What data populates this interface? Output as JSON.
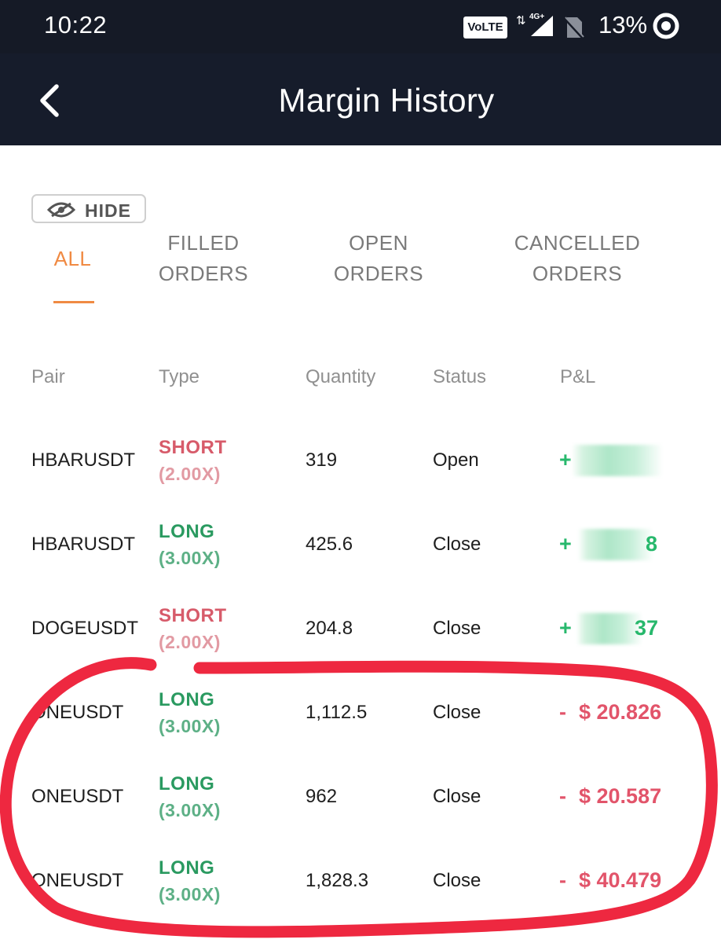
{
  "status_bar": {
    "time": "10:22",
    "volte": "VoLTE",
    "network": "4G+",
    "battery": "13%"
  },
  "header": {
    "title": "Margin History"
  },
  "filter": {
    "hide_label": "HIDE"
  },
  "tabs": [
    {
      "line1": "ALL",
      "line2": "",
      "active": true
    },
    {
      "line1": "FILLED",
      "line2": "ORDERS",
      "active": false
    },
    {
      "line1": "OPEN",
      "line2": "ORDERS",
      "active": false
    },
    {
      "line1": "CANCELLED",
      "line2": "ORDERS",
      "active": false
    }
  ],
  "table": {
    "columns": [
      "Pair",
      "Type",
      "Quantity",
      "Status",
      "P&L"
    ],
    "rows": [
      {
        "pair": "HBARUSDT",
        "side": "SHORT",
        "leverage": "(2.00X)",
        "quantity": "319",
        "status": "Open",
        "pnl_sign": "+",
        "pnl_value": "",
        "pnl_visible": "",
        "pnl_redacted": true
      },
      {
        "pair": "HBARUSDT",
        "side": "LONG",
        "leverage": "(3.00X)",
        "quantity": "425.6",
        "status": "Close",
        "pnl_sign": "+",
        "pnl_value": "",
        "pnl_visible": "8",
        "pnl_redacted": true
      },
      {
        "pair": "DOGEUSDT",
        "side": "SHORT",
        "leverage": "(2.00X)",
        "quantity": "204.8",
        "status": "Close",
        "pnl_sign": "+",
        "pnl_value": "",
        "pnl_visible": "37",
        "pnl_redacted": true
      },
      {
        "pair": "ONEUSDT",
        "side": "LONG",
        "leverage": "(3.00X)",
        "quantity": "1,112.5",
        "status": "Close",
        "pnl_sign": "-",
        "pnl_value": "$ 20.826",
        "pnl_redacted": false
      },
      {
        "pair": "ONEUSDT",
        "side": "LONG",
        "leverage": "(3.00X)",
        "quantity": "962",
        "status": "Close",
        "pnl_sign": "-",
        "pnl_value": "$ 20.587",
        "pnl_redacted": false
      },
      {
        "pair": "ONEUSDT",
        "side": "LONG",
        "leverage": "(3.00X)",
        "quantity": "1,828.3",
        "status": "Close",
        "pnl_sign": "-",
        "pnl_value": "$ 40.479",
        "pnl_redacted": false
      }
    ]
  },
  "colors": {
    "header_bg": "#161c2b",
    "accent_tab": "#f08a43",
    "short": "#d75b6a",
    "long": "#2a9a60",
    "profit": "#27b86c",
    "loss": "#e2546a",
    "annotation": "#ee2840"
  },
  "icons": [
    "back-arrow-icon",
    "eye-slash-icon",
    "signal-icon",
    "no-sim-icon",
    "battery-ring-icon"
  ]
}
